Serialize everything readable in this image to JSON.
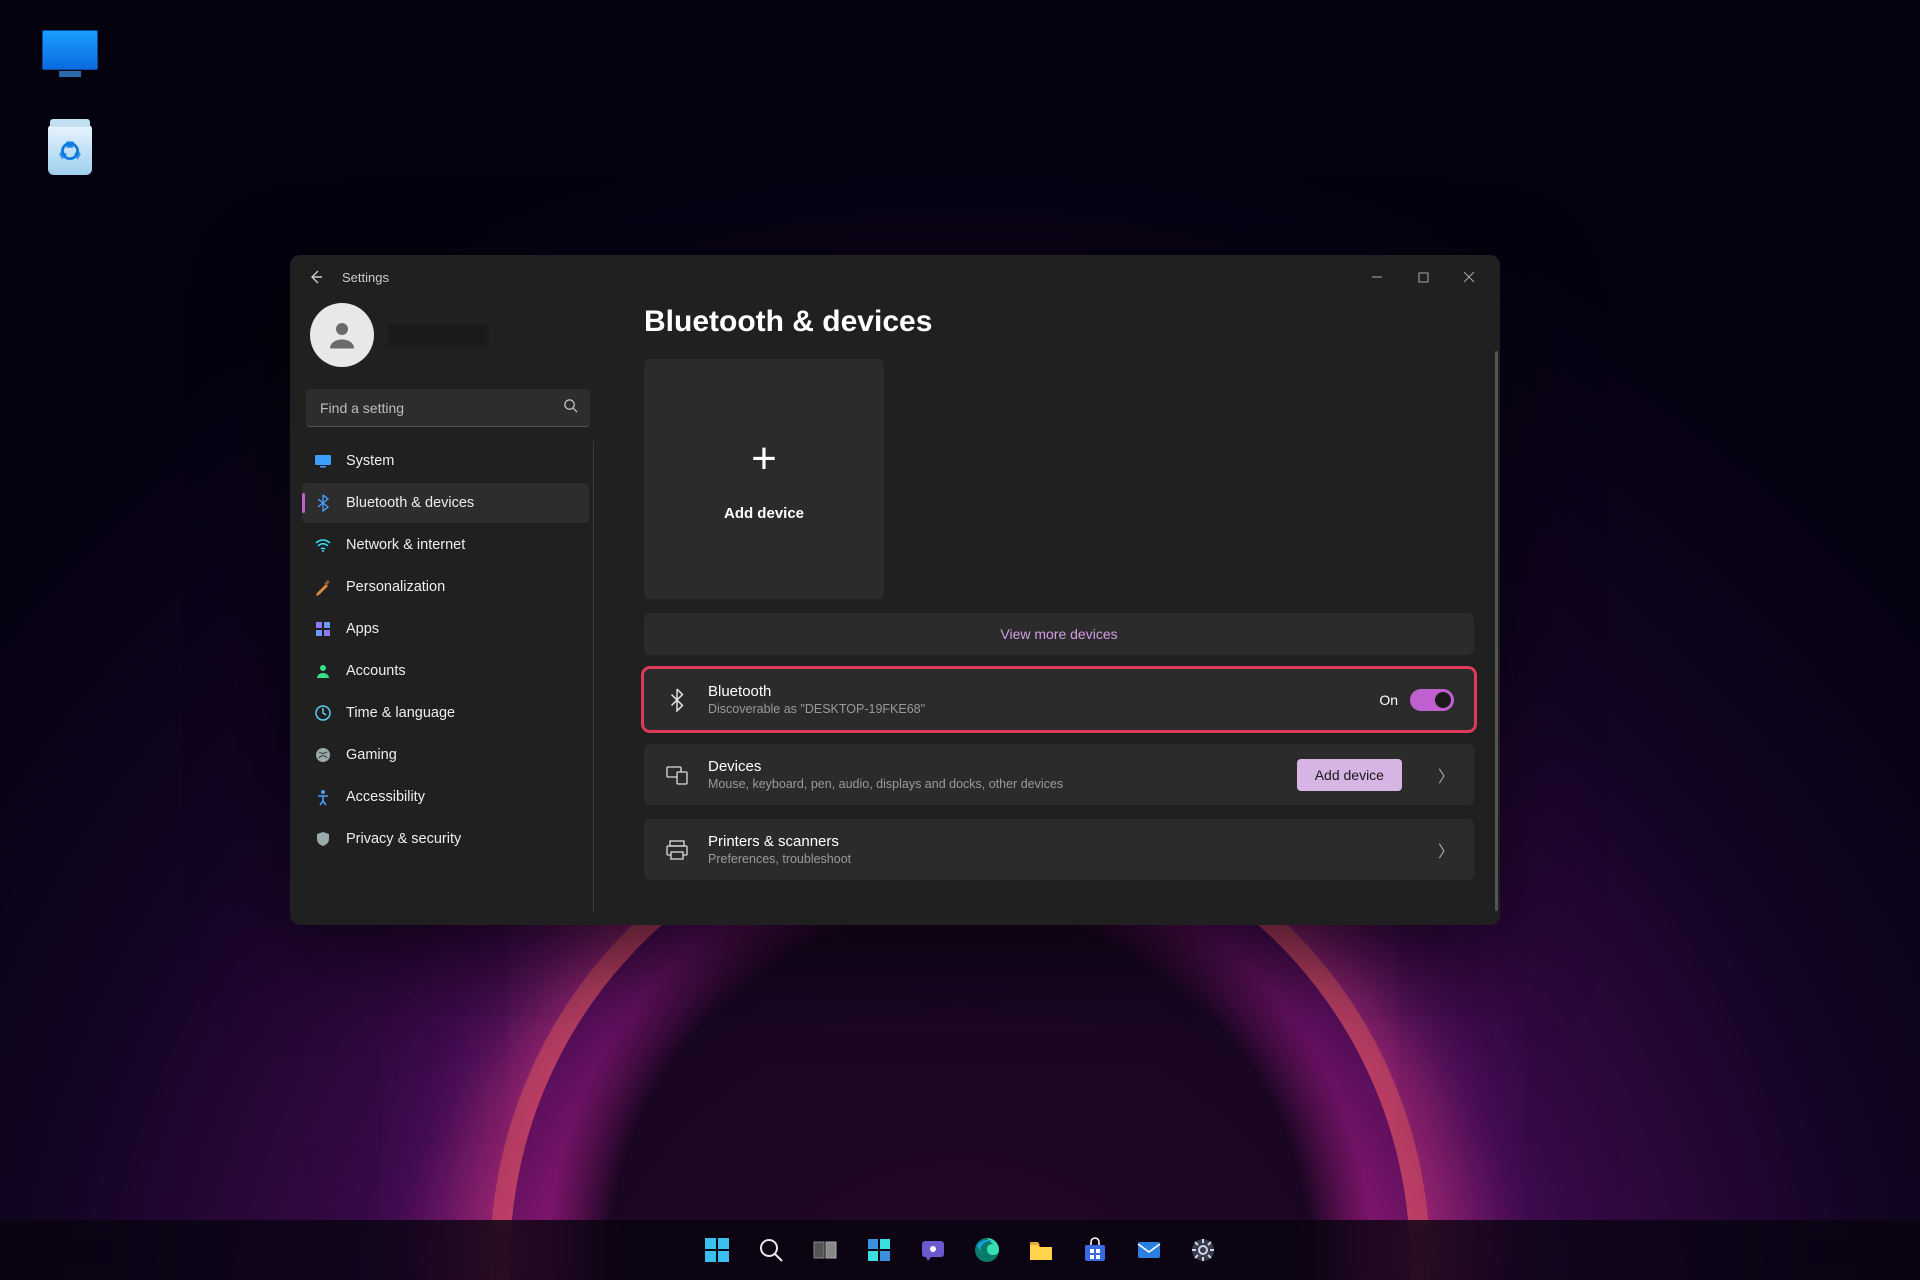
{
  "desktop_icons": {
    "this_pc": "",
    "recycle_bin": ""
  },
  "window": {
    "title": "Settings",
    "user_name": "",
    "search_placeholder": "Find a setting",
    "nav": [
      {
        "label": "System"
      },
      {
        "label": "Bluetooth & devices"
      },
      {
        "label": "Network & internet"
      },
      {
        "label": "Personalization"
      },
      {
        "label": "Apps"
      },
      {
        "label": "Accounts"
      },
      {
        "label": "Time & language"
      },
      {
        "label": "Gaming"
      },
      {
        "label": "Accessibility"
      },
      {
        "label": "Privacy & security"
      }
    ],
    "page": {
      "heading": "Bluetooth & devices",
      "add_device_label": "Add device",
      "view_more_label": "View more devices",
      "bluetooth_row": {
        "title": "Bluetooth",
        "subtitle": "Discoverable as \"DESKTOP-19FKE68\"",
        "toggle_label": "On"
      },
      "devices_row": {
        "title": "Devices",
        "subtitle": "Mouse, keyboard, pen, audio, displays and docks, other devices",
        "button_label": "Add device"
      },
      "printers_row": {
        "title": "Printers & scanners",
        "subtitle": "Preferences, troubleshoot"
      }
    }
  },
  "colors": {
    "accent": "#c060d0",
    "highlight": "#e03a5a"
  }
}
